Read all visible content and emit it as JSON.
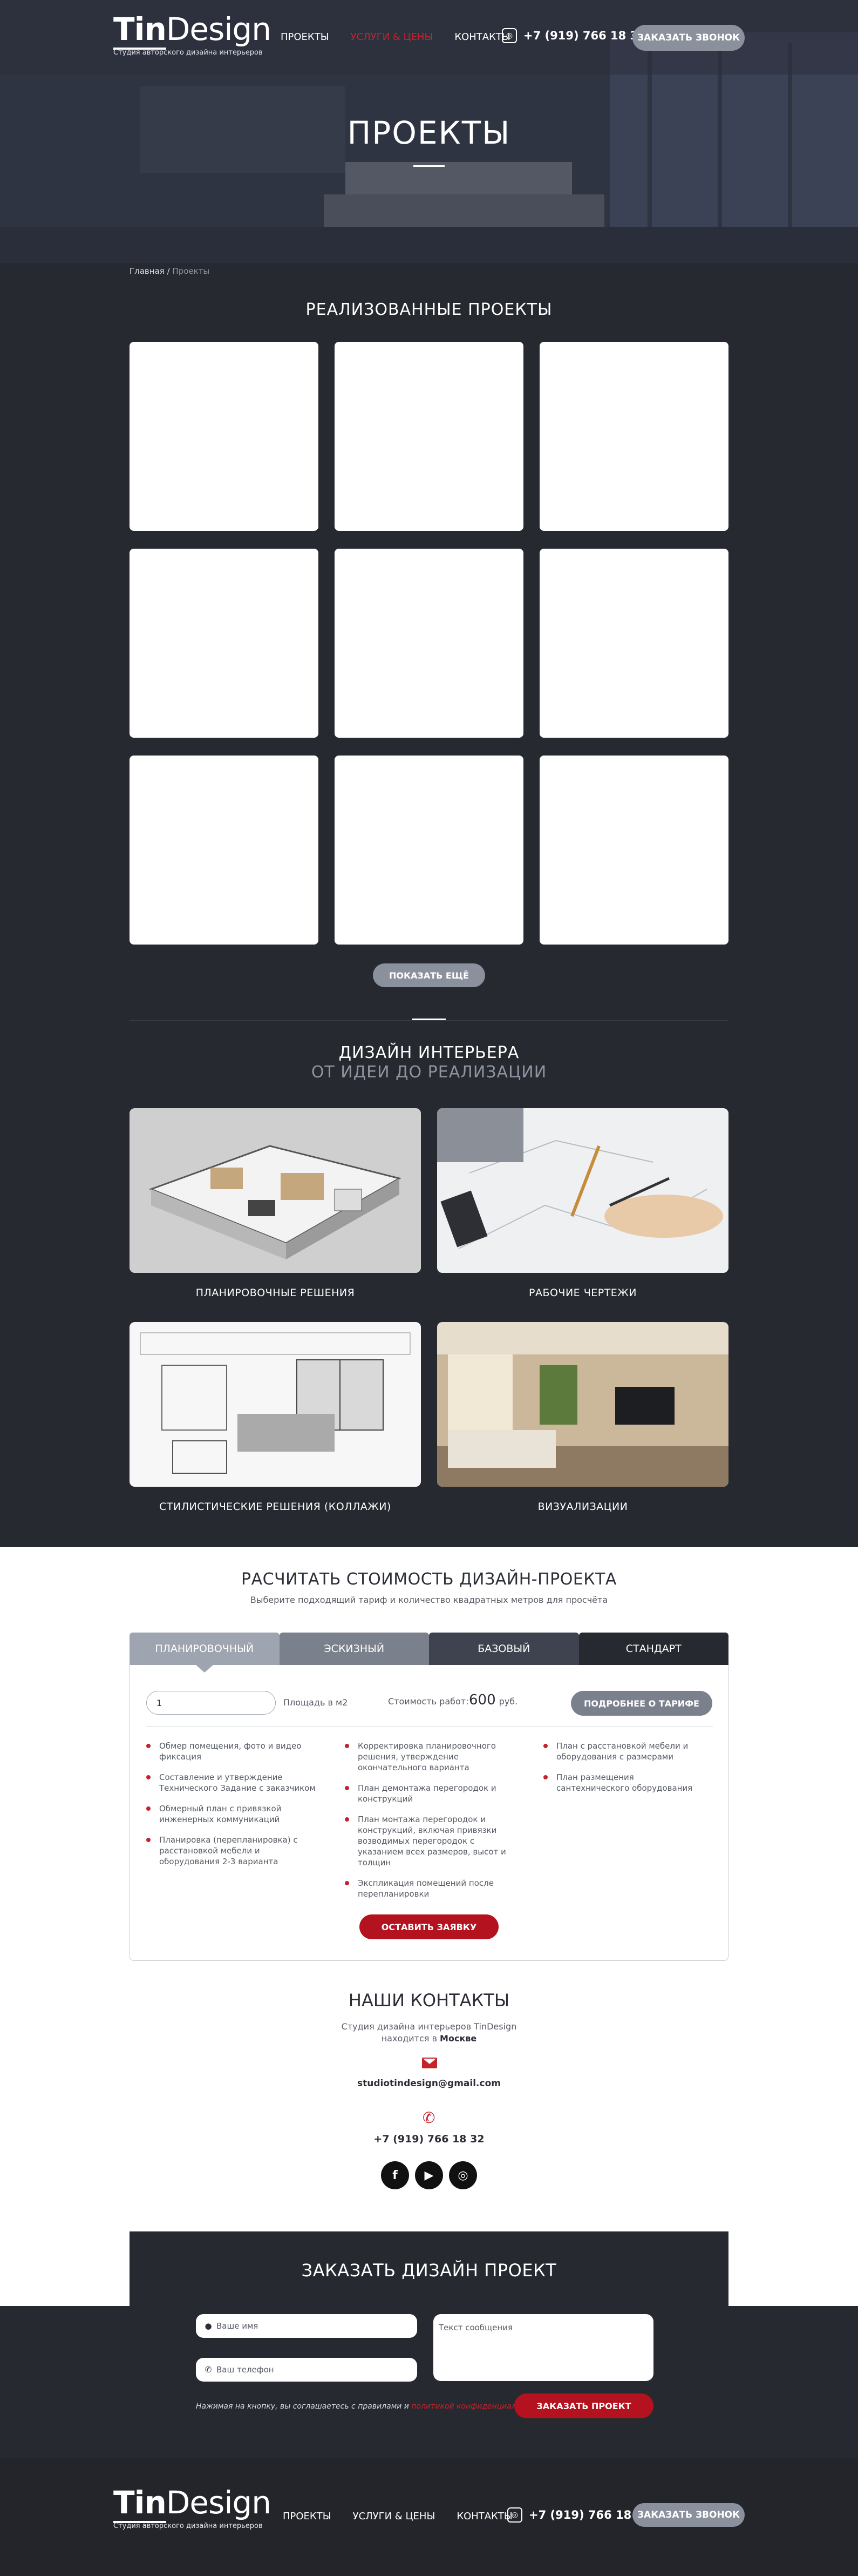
{
  "header": {
    "logo_text_a": "Tin",
    "logo_text_b": "Design",
    "logo_tagline": "Студия авторского дизайна интерьеров",
    "nav": [
      "ПРОЕКТЫ",
      "УСЛУГИ & ЦЕНЫ",
      "КОНТАКТЫ"
    ],
    "phone": "+7 (919) 766 18 32",
    "callback_button": "ЗАКАЗАТЬ ЗВОНОК"
  },
  "hero": {
    "title": "ПРОЕКТЫ",
    "breadcrumb_home": "Главная",
    "breadcrumb_sep": "/",
    "breadcrumb_current": "Проекты"
  },
  "projects": {
    "title": "РЕАЛИЗОВАННЫЕ ПРОЕКТЫ",
    "show_more": "ПОКАЗАТЬ ЕЩЁ"
  },
  "design": {
    "title": "ДИЗАЙН ИНТЕРЬЕРА",
    "subtitle": "ОТ ИДЕИ ДО РЕАЛИЗАЦИИ",
    "services": [
      "ПЛАНИРОВОЧНЫЕ РЕШЕНИЯ",
      "РАБОЧИЕ ЧЕРТЕЖИ",
      "СТИЛИСТИЧЕСКИЕ РЕШЕНИЯ (КОЛЛАЖИ)",
      "ВИЗУАЛИЗАЦИИ"
    ]
  },
  "calculator": {
    "title": "РАСЧИТАТЬ СТОИМОСТЬ ДИЗАЙН-ПРОЕКТА",
    "subtitle": "Выберите подходящий тариф и количество квадратных метров для проcчёта",
    "tabs": [
      "ПЛАНИРОВОЧНЫЙ",
      "ЭСКИЗНЫЙ",
      "БАЗОВЫЙ",
      "СТАНДАРТ"
    ],
    "area_value": "1",
    "area_label": "Площадь в м2",
    "cost_label": "Стоимость работ:",
    "cost_value": "600",
    "cost_unit": "руб.",
    "more_button": "ПОДРОБНЕЕ О ТАРИФЕ",
    "col1": [
      "Обмер помещения, фото и видео фиксация",
      "Составление и утверждение Технического Задание с заказчиком",
      "Обмерный план с привязкой инженерных коммуникаций",
      "Планировка (перепланировка) с расстановкой мебели и оборудования 2-3 варианта"
    ],
    "col2": [
      "Корректировка планировочного решения, утверждение окончательного варианта",
      "План демонтажа перегородок и конструкций",
      "План монтажа перегородок и конструкций, включая привязки возводимых перегородок с указанием всех размеров, высот и толщин",
      "Экспликация помещений после перепланировки"
    ],
    "col3": [
      "План с расстановкой мебели и оборудования с размерами",
      "План размещения сантехнического оборудования"
    ],
    "submit": "ОСТАВИТЬ ЗАЯВКУ"
  },
  "contacts": {
    "title": "НАШИ КОНТАКТЫ",
    "line1": "Студия дизайна интерьеров TinDesign",
    "line2_prefix": "находится в",
    "city": "Москве",
    "email": "studiotindesign@gmail.com",
    "phone": "+7 (919) 766 18 32",
    "socials": [
      "f",
      "▶",
      "◎"
    ]
  },
  "order": {
    "title": "ЗАКАЗАТЬ ДИЗАЙН ПРОЕКТ",
    "name_placeholder": "Ваше имя",
    "phone_placeholder": "Ваш телефон",
    "message_placeholder": "Текст сообщения",
    "agree_text": "Нажимая на кнопку, вы соглашаетесь с правилами и",
    "agree_link": "политикой конфиденциальности",
    "submit": "ЗАКАЗАТЬ ПРОЕКТ"
  },
  "footer": {
    "nav": [
      "ПРОЕКТЫ",
      "УСЛУГИ & ЦЕНЫ",
      "КОНТАКТЫ"
    ],
    "phone": "+7 (919) 766 18 32",
    "callback_button": "ЗАКАЗАТЬ ЗВОНОК"
  },
  "colors": {
    "accent_red": "#c6222c",
    "dark_bg": "#262930",
    "grey_button": "#8a909c"
  }
}
